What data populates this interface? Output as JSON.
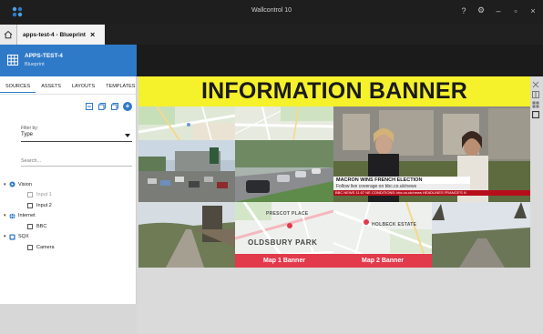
{
  "app": {
    "title": "Wallcontrol 10"
  },
  "window_controls": {
    "help": "?",
    "settings": "⚙",
    "minimize": "–",
    "maximize": "▫",
    "close": "×"
  },
  "tab": {
    "label": "apps-test-4 - Blueprint",
    "close": "×"
  },
  "panel": {
    "name": "APPS-TEST-4",
    "subtitle": "Blueprint",
    "tabs": [
      "SOURCES",
      "ASSETS",
      "LAYOUTS",
      "TEMPLATES"
    ],
    "active_tab": "SOURCES",
    "filter_label": "Filter by:",
    "filter_value": "Type",
    "search_placeholder": "Search..."
  },
  "tree": {
    "groups": [
      {
        "label": "Vision",
        "icon": "vision-icon",
        "children": [
          {
            "label": "Input 1",
            "disabled": true
          },
          {
            "label": "Input 2",
            "disabled": false
          }
        ]
      },
      {
        "label": "Internet",
        "icon": "globe-icon",
        "children": [
          {
            "label": "BBC",
            "disabled": false
          }
        ]
      },
      {
        "label": "SQX",
        "icon": "sqx-icon",
        "children": [
          {
            "label": "Camera",
            "disabled": false
          }
        ]
      }
    ]
  },
  "wall": {
    "banner_text": "INFORMATION BANNER",
    "map1_label": "Map 1 Banner",
    "map2_label": "Map 2 Banner",
    "map1_places": {
      "top": "PRESCOT PLACE",
      "big": "OLDSBURY PARK"
    },
    "map2_places": {
      "top": "HOLBECK ESTATE"
    },
    "news": {
      "headline": "MACRON WINS FRENCH ELECTION",
      "sub": "Follow live coverage on bbc.co.uk/news",
      "ticker": "BBC NEWS   11:07  NE CONDITIONS: bbc.co.uk/news   HEADLINES  FRANCE'S N"
    }
  },
  "colors": {
    "accent": "#2f7ac8",
    "banner": "#f5f12a",
    "map_label": "#e2394b",
    "titlebar": "#1e1e1e"
  }
}
